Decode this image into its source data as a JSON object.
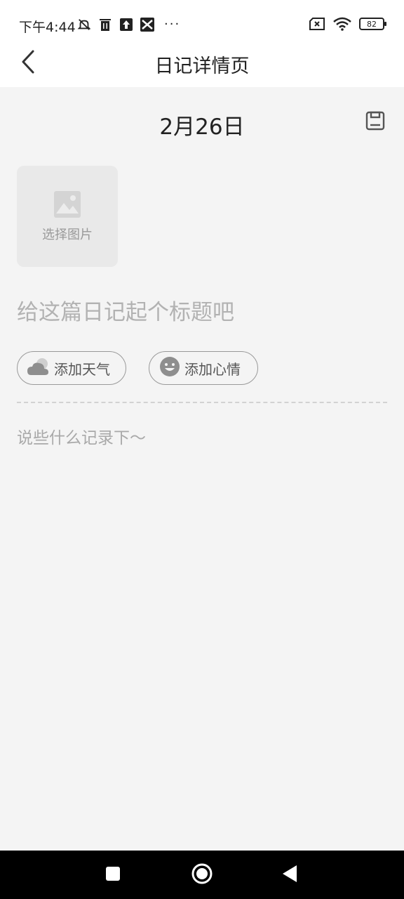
{
  "status_bar": {
    "time": "下午4:44",
    "left_icons": [
      "mute-bell-icon",
      "trash-icon",
      "upload-icon",
      "app-icon"
    ],
    "more": "···",
    "battery": "82",
    "right_icons": [
      "no-sim-icon",
      "wifi-icon",
      "battery-icon"
    ]
  },
  "app_bar": {
    "title": "日记详情页",
    "back_icon": "chevron-left-icon"
  },
  "diary": {
    "date": "2月26日",
    "save_icon": "save-icon",
    "image_picker_label": "选择图片",
    "title_placeholder": "给这篇日记起个标题吧",
    "add_weather_label": "添加天气",
    "add_mood_label": "添加心情",
    "body_placeholder": "说些什么记录下～"
  },
  "nav_bar": {
    "icons": [
      "recent-apps-icon",
      "home-icon",
      "back-triangle-icon"
    ]
  },
  "colors": {
    "page_bg": "#f4f4f4",
    "bar_bg": "#ffffff",
    "placeholder": "#b2b2b2",
    "nav_bg": "#000000"
  }
}
